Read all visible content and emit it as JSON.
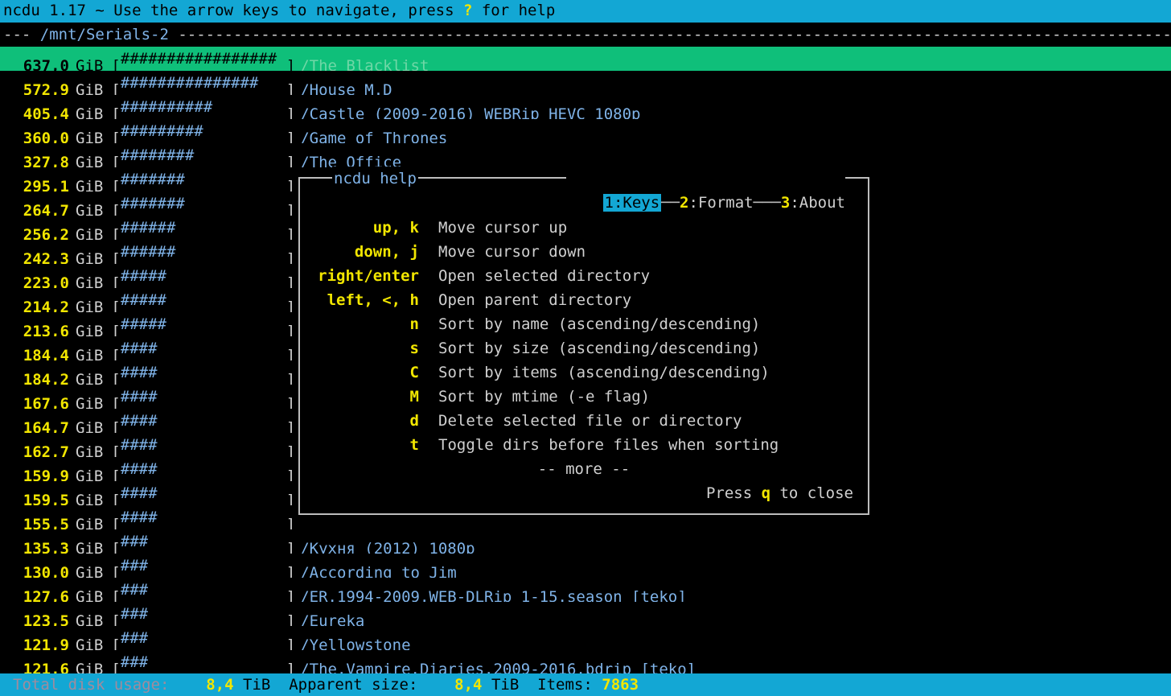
{
  "title": {
    "prefix": "ncdu 1.17 ~ Use the arrow keys to navigate, press ",
    "key": "?",
    "suffix": " for help"
  },
  "path": "/mnt/Serials-2",
  "colors": {
    "accent": "#13a7d4",
    "selected": "#0fbf7a",
    "number": "#f2e600",
    "link": "#7fb3e8"
  },
  "rows": [
    {
      "size": "637,0",
      "unit": "GiB",
      "bar": "#################",
      "name": "/The Blacklist",
      "selected": true
    },
    {
      "size": "572,9",
      "unit": "GiB",
      "bar": "###############",
      "name": "/House M.D"
    },
    {
      "size": "405,4",
      "unit": "GiB",
      "bar": "##########",
      "name": "/Castle (2009-2016) WEBRip HEVC 1080p"
    },
    {
      "size": "360,0",
      "unit": "GiB",
      "bar": "#########",
      "name": "/Game of Thrones"
    },
    {
      "size": "327,8",
      "unit": "GiB",
      "bar": "########",
      "name": "/The Office"
    },
    {
      "size": "295,1",
      "unit": "GiB",
      "bar": "#######",
      "name": ""
    },
    {
      "size": "264,7",
      "unit": "GiB",
      "bar": "#######",
      "name": ""
    },
    {
      "size": "256,2",
      "unit": "GiB",
      "bar": "######",
      "name": ""
    },
    {
      "size": "242,3",
      "unit": "GiB",
      "bar": "######",
      "name": ""
    },
    {
      "size": "223,0",
      "unit": "GiB",
      "bar": "#####",
      "name": ""
    },
    {
      "size": "214,2",
      "unit": "GiB",
      "bar": "#####",
      "name": ""
    },
    {
      "size": "213,6",
      "unit": "GiB",
      "bar": "#####",
      "name": ""
    },
    {
      "size": "184,4",
      "unit": "GiB",
      "bar": "####",
      "name": ""
    },
    {
      "size": "184,2",
      "unit": "GiB",
      "bar": "####",
      "name": ""
    },
    {
      "size": "167,6",
      "unit": "GiB",
      "bar": "####",
      "name": ""
    },
    {
      "size": "164,7",
      "unit": "GiB",
      "bar": "####",
      "name": ""
    },
    {
      "size": "162,7",
      "unit": "GiB",
      "bar": "####",
      "name": ""
    },
    {
      "size": "159,9",
      "unit": "GiB",
      "bar": "####",
      "name": ""
    },
    {
      "size": "159,5",
      "unit": "GiB",
      "bar": "####",
      "name": ""
    },
    {
      "size": "155,5",
      "unit": "GiB",
      "bar": "####",
      "name": ""
    },
    {
      "size": "135,3",
      "unit": "GiB",
      "bar": "###",
      "name": "/Кухня (2012) 1080p"
    },
    {
      "size": "130,0",
      "unit": "GiB",
      "bar": "###",
      "name": "/According to Jim"
    },
    {
      "size": "127,6",
      "unit": "GiB",
      "bar": "###",
      "name": "/ER.1994-2009.WEB-DLRip_1-15.season_[teko]"
    },
    {
      "size": "123,5",
      "unit": "GiB",
      "bar": "###",
      "name": "/Eureka"
    },
    {
      "size": "121,9",
      "unit": "GiB",
      "bar": "###",
      "name": "/Yellowstone"
    },
    {
      "size": "121,6",
      "unit": "GiB",
      "bar": "###",
      "name": "/The.Vampire.Diaries.2009-2016.bdrip_[teko]"
    }
  ],
  "help": {
    "title": "ncdu help",
    "tabs": [
      {
        "num": "1",
        "label": ":Keys",
        "active": true
      },
      {
        "num": "2",
        "label": ":Format"
      },
      {
        "num": "3",
        "label": ":About"
      }
    ],
    "keys": [
      {
        "key": "up, k",
        "desc": "Move cursor up"
      },
      {
        "key": "down, j",
        "desc": "Move cursor down"
      },
      {
        "key": "right/enter",
        "desc": "Open selected directory"
      },
      {
        "key": "left, <, h",
        "desc": "Open parent directory"
      },
      {
        "key": "n",
        "desc": "Sort by name (ascending/descending)"
      },
      {
        "key": "s",
        "desc": "Sort by size (ascending/descending)"
      },
      {
        "key": "C",
        "desc": "Sort by items (ascending/descending)"
      },
      {
        "key": "M",
        "desc": "Sort by mtime (-e flag)"
      },
      {
        "key": "d",
        "desc": "Delete selected file or directory"
      },
      {
        "key": "t",
        "desc": "Toggle dirs before files when sorting"
      }
    ],
    "more": "-- more --",
    "close_prefix": "Press ",
    "close_key": "q",
    "close_suffix": " to close"
  },
  "footer": {
    "total_label": "Total disk usage:",
    "total_value": "8,4",
    "total_unit": "TiB",
    "apparent_label": "Apparent size:",
    "apparent_value": "8,4",
    "apparent_unit": "TiB",
    "items_label": "Items:",
    "items_value": "7863"
  }
}
